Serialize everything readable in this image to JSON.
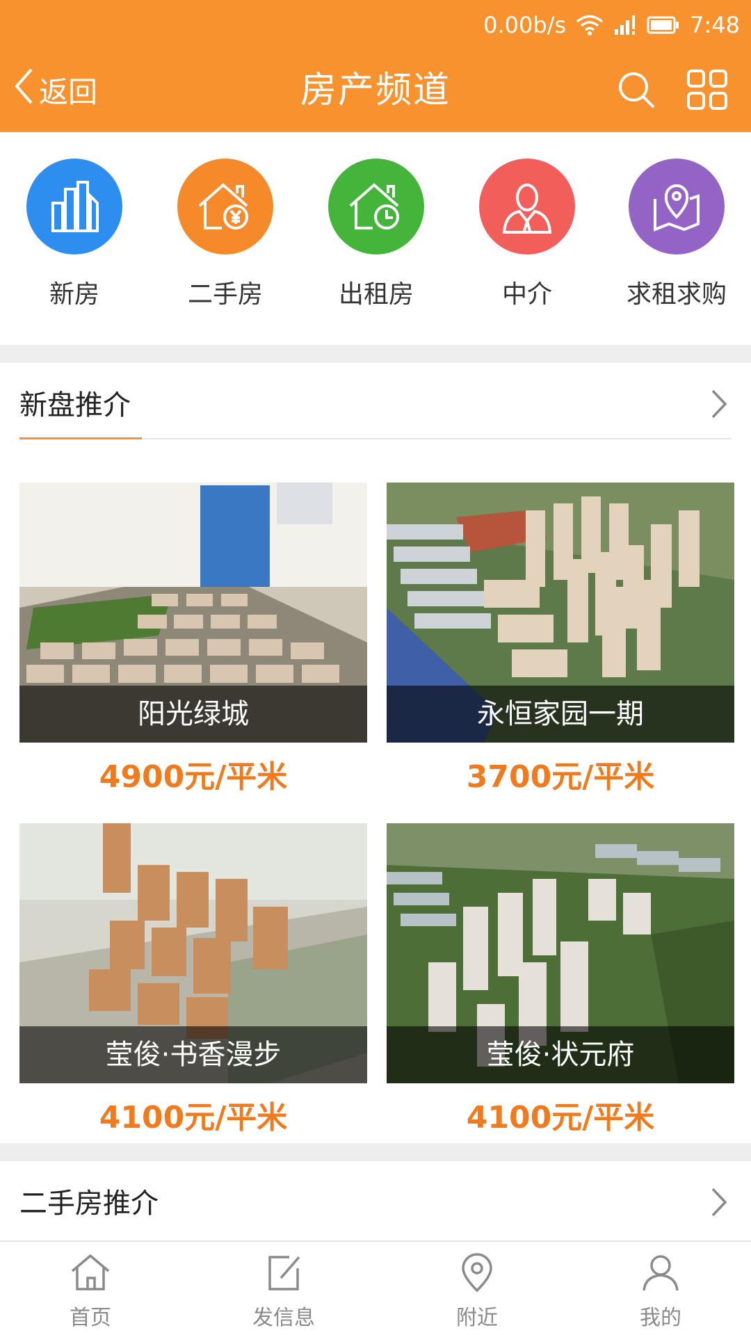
{
  "status_bar": {
    "speed": "0.00b/s",
    "time": "7:48"
  },
  "header": {
    "back_label": "返回",
    "title": "房产频道",
    "search_icon": "search-icon",
    "menu_icon": "grid-menu-icon",
    "background_color": "#f7922f"
  },
  "categories": [
    {
      "label": "新房",
      "icon": "buildings-icon",
      "color": "#2e8ef0"
    },
    {
      "label": "二手房",
      "icon": "house-yuan-icon",
      "color": "#f68a2a"
    },
    {
      "label": "出租房",
      "icon": "house-clock-icon",
      "color": "#44b53a"
    },
    {
      "label": "中介",
      "icon": "agent-person-icon",
      "color": "#f25e5a"
    },
    {
      "label": "求租求购",
      "icon": "map-pin-icon",
      "color": "#9463c6"
    }
  ],
  "new_properties": {
    "title": "新盘推介",
    "items": [
      {
        "name": "阳光绿城",
        "price": "4900元/平米"
      },
      {
        "name": "永恒家园一期",
        "price": "3700元/平米"
      },
      {
        "name": "莹俊·书香漫步",
        "price": "4100元/平米"
      },
      {
        "name": "莹俊·状元府",
        "price": "4100元/平米"
      }
    ]
  },
  "secondhand_section": {
    "title": "二手房推介"
  },
  "tabbar": [
    {
      "label": "首页",
      "icon": "home-icon"
    },
    {
      "label": "发信息",
      "icon": "edit-icon"
    },
    {
      "label": "附近",
      "icon": "location-icon"
    },
    {
      "label": "我的",
      "icon": "user-icon"
    }
  ],
  "colors": {
    "accent": "#f7922f",
    "price": "#f07a1e"
  }
}
